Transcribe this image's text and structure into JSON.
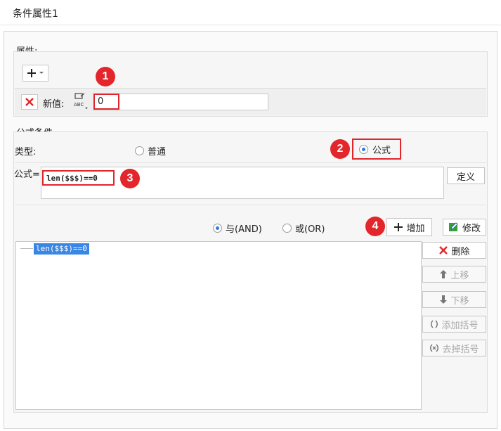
{
  "title": "条件属性1",
  "properties": {
    "group_label": "属性:",
    "new_value_label": "新值:",
    "new_value": "0",
    "value_type_icon": "abc-type-icon"
  },
  "formula_condition": {
    "group_label": "公式条件",
    "type_label": "类型:",
    "type_options": [
      "普通",
      "公式"
    ],
    "selected_type": "公式",
    "formula_label": "公式=",
    "formula_value": "len($$$)==0",
    "define_button": "定义",
    "logic_options": [
      "与(AND)",
      "或(OR)"
    ],
    "selected_logic": "与(AND)",
    "add_button": "增加",
    "modify_button": "修改",
    "conditions": [
      "len($$$)==0"
    ],
    "side_buttons": {
      "delete": "删除",
      "move_up": "上移",
      "move_down": "下移",
      "add_bracket": "添加括号",
      "remove_bracket": "去掉括号"
    }
  },
  "annotations": [
    "1",
    "2",
    "3",
    "4"
  ],
  "colors": {
    "accent_red": "#e3262b",
    "selection_blue": "#3a86e4"
  }
}
